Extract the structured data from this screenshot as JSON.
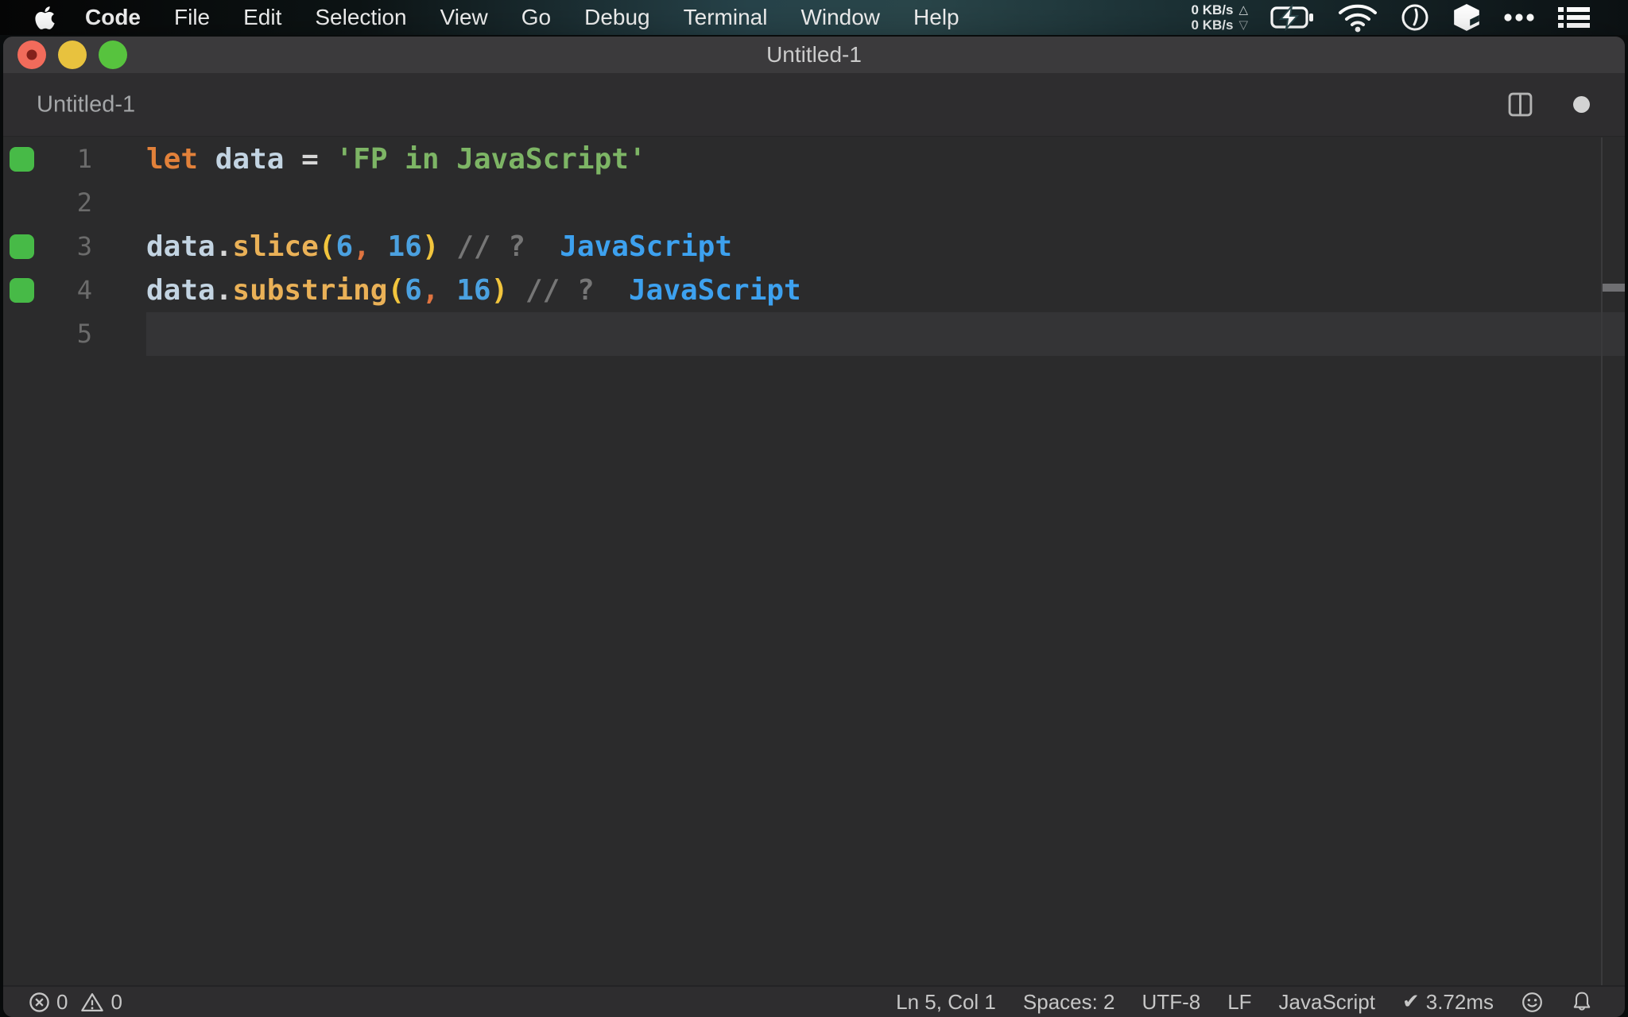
{
  "menubar": {
    "active_app": "Code",
    "items": [
      "Code",
      "File",
      "Edit",
      "Selection",
      "View",
      "Go",
      "Debug",
      "Terminal",
      "Window",
      "Help"
    ],
    "status": {
      "network_up": "0 KB/s",
      "network_down": "0 KB/s",
      "up_arrow": "△",
      "down_arrow": "▽",
      "icons": [
        "battery-charging-icon",
        "wifi-icon",
        "clock-icon",
        "cube-icon",
        "more-dots-icon",
        "list-icon"
      ]
    }
  },
  "window": {
    "title": "Untitled-1",
    "tab": {
      "label": "Untitled-1",
      "modified": true
    }
  },
  "editor": {
    "language": "JavaScript",
    "lines": [
      {
        "num": "1",
        "marker": true,
        "current": false,
        "tokens": [
          [
            "kw",
            "let"
          ],
          [
            "pln",
            " "
          ],
          [
            "var",
            "data"
          ],
          [
            "pln",
            " "
          ],
          [
            "op",
            "="
          ],
          [
            "pln",
            " "
          ],
          [
            "str",
            "'FP in JavaScript'"
          ]
        ]
      },
      {
        "num": "2",
        "marker": false,
        "current": false,
        "tokens": []
      },
      {
        "num": "3",
        "marker": true,
        "current": false,
        "tokens": [
          [
            "var",
            "data"
          ],
          [
            "pln",
            "."
          ],
          [
            "fn",
            "slice"
          ],
          [
            "par",
            "("
          ],
          [
            "num",
            "6"
          ],
          [
            "com",
            ","
          ],
          [
            "num",
            " 16"
          ],
          [
            "par",
            ")"
          ],
          [
            "cmt",
            " // ?"
          ],
          [
            "pln",
            "  "
          ],
          [
            "ann",
            "JavaScript"
          ]
        ]
      },
      {
        "num": "4",
        "marker": true,
        "current": false,
        "tokens": [
          [
            "var",
            "data"
          ],
          [
            "pln",
            "."
          ],
          [
            "fn",
            "substring"
          ],
          [
            "par",
            "("
          ],
          [
            "num",
            "6"
          ],
          [
            "com",
            ","
          ],
          [
            "num",
            " 16"
          ],
          [
            "par",
            ")"
          ],
          [
            "cmt",
            " // ?"
          ],
          [
            "pln",
            "  "
          ],
          [
            "ann",
            "JavaScript"
          ]
        ]
      },
      {
        "num": "5",
        "marker": false,
        "current": true,
        "tokens": []
      }
    ]
  },
  "statusbar": {
    "errors": "0",
    "warnings": "0",
    "items": [
      {
        "name": "cursor-position",
        "label": "Ln 5, Col 1"
      },
      {
        "name": "indentation",
        "label": "Spaces: 2"
      },
      {
        "name": "encoding",
        "label": "UTF-8"
      },
      {
        "name": "eol-sequence",
        "label": "LF"
      },
      {
        "name": "language-mode",
        "label": "JavaScript"
      },
      {
        "name": "quokka-runtime",
        "label": "3.72ms",
        "icon": "check",
        "check_glyph": "✔"
      }
    ]
  },
  "colors": {
    "coverage_marker_green": "#47ba47",
    "inline_value_blue": "#3da1ef",
    "keyword_orange": "#e2813a",
    "string_green": "#7db565",
    "number_blue": "#4ba1e0",
    "function_yellow": "#eab157",
    "paren_gold": "#f2c53d",
    "traffic_red": "#f26b5b",
    "traffic_yellow": "#e8c23e",
    "traffic_green": "#57c33e",
    "menubar_teal": "#2a464a",
    "editor_bg": "#2b2b2c"
  }
}
